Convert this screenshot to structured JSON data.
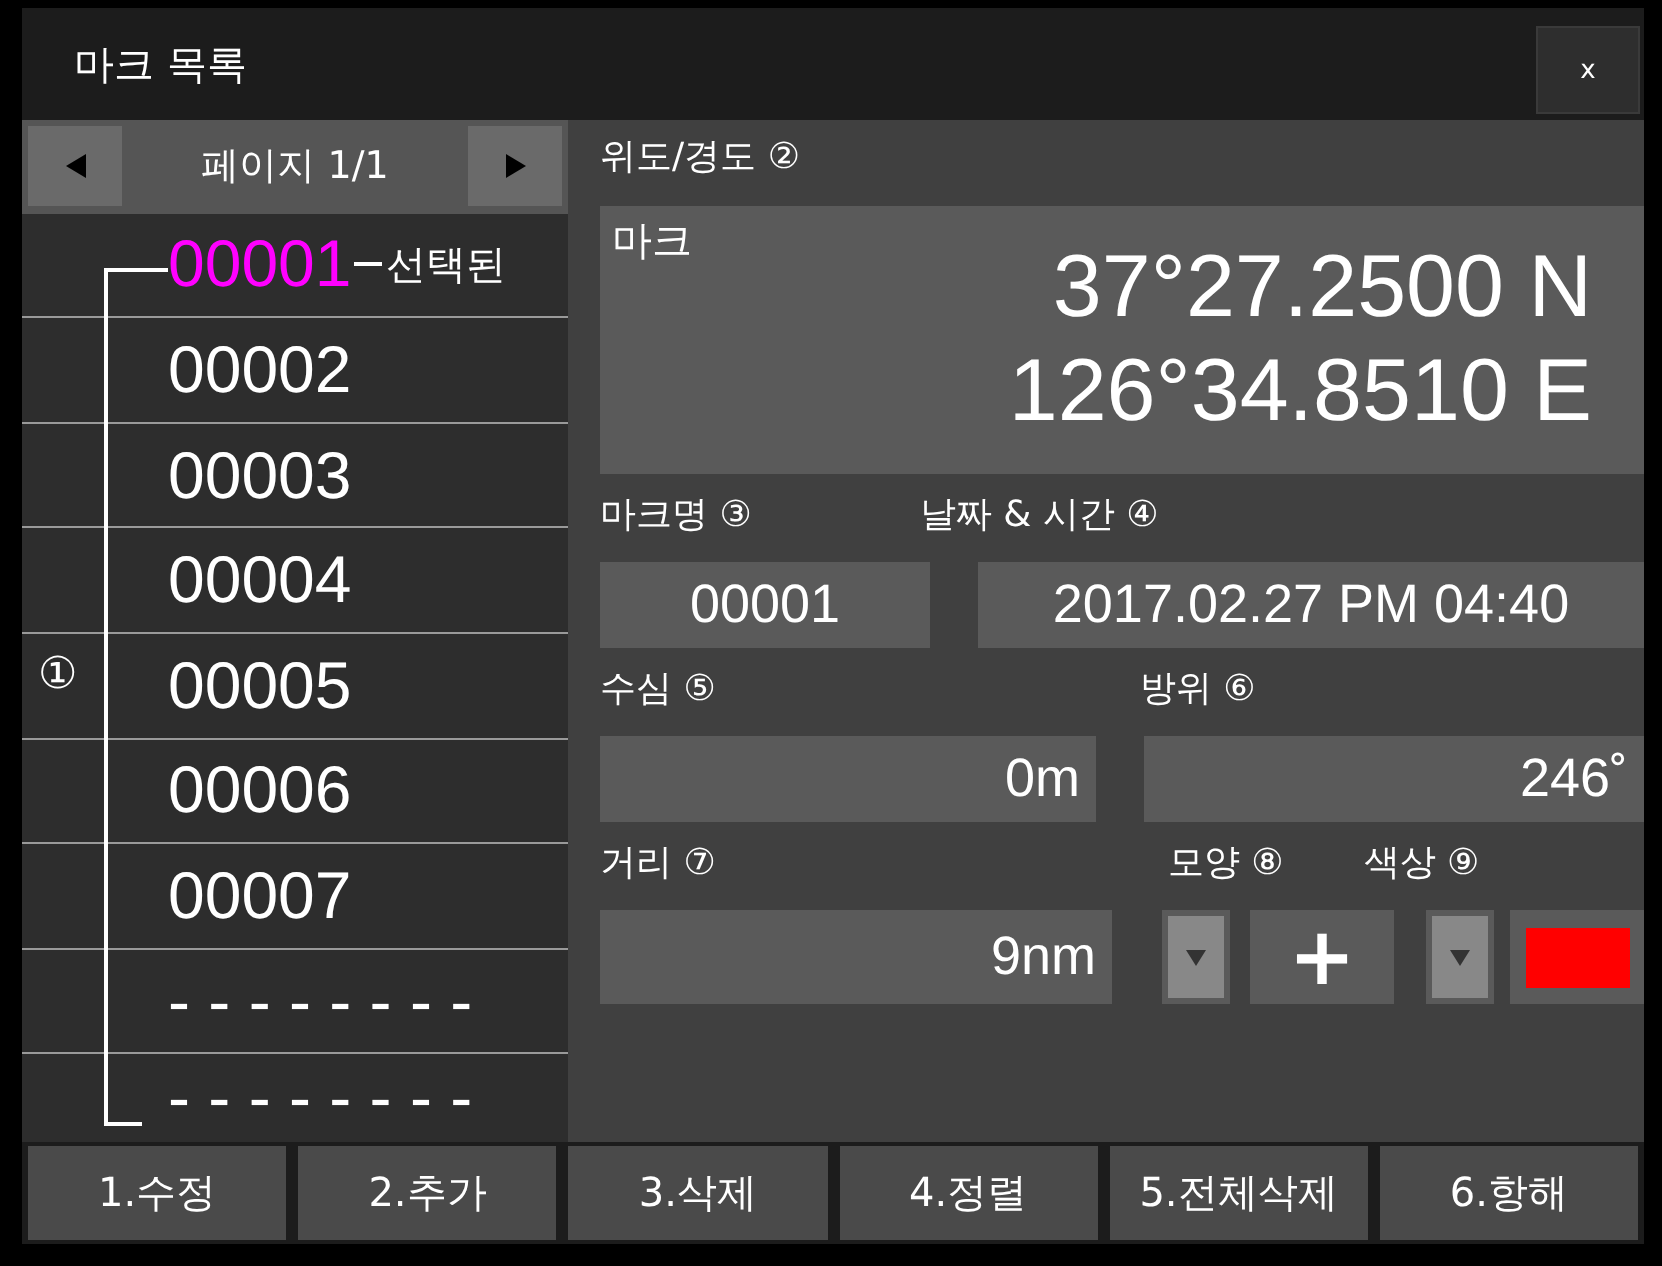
{
  "window": {
    "title": "마크 목록",
    "close": "x"
  },
  "pager": {
    "label": "페이지 1/1"
  },
  "list": {
    "annotation": "①",
    "selected_note": "선택된",
    "items": [
      {
        "label": "00001",
        "selected": true
      },
      {
        "label": "00002",
        "selected": false
      },
      {
        "label": "00003",
        "selected": false
      },
      {
        "label": "00004",
        "selected": false
      },
      {
        "label": "00005",
        "selected": false
      },
      {
        "label": "00006",
        "selected": false
      },
      {
        "label": "00007",
        "selected": false
      },
      {
        "label": "- - - - - - - -",
        "selected": false
      },
      {
        "label": "- - - - - - - -",
        "selected": false
      }
    ]
  },
  "position": {
    "label": "위도/경도",
    "number": "②",
    "caption": "마크",
    "latitude": "37°27.2500 N",
    "longitude": "126°34.8510 E"
  },
  "mark_name": {
    "label": "마크명",
    "number": "③",
    "value": "00001"
  },
  "datetime": {
    "label": "날짜 & 시간",
    "number": "④",
    "value": "2017.02.27 PM 04:40"
  },
  "depth": {
    "label": "수심",
    "number": "⑤",
    "value": "0m"
  },
  "bearing": {
    "label": "방위",
    "number": "⑥",
    "value": "246˚"
  },
  "distance": {
    "label": "거리",
    "number": "⑦",
    "value": "9nm"
  },
  "shape": {
    "label": "모양",
    "number": "⑧",
    "value": "+"
  },
  "color": {
    "label": "색상",
    "number": "⑨",
    "color": "#ff0000"
  },
  "buttons": [
    "1.수정",
    "2.추가",
    "3.삭제",
    "4.정렬",
    "5.전체삭제",
    "6.항해"
  ]
}
